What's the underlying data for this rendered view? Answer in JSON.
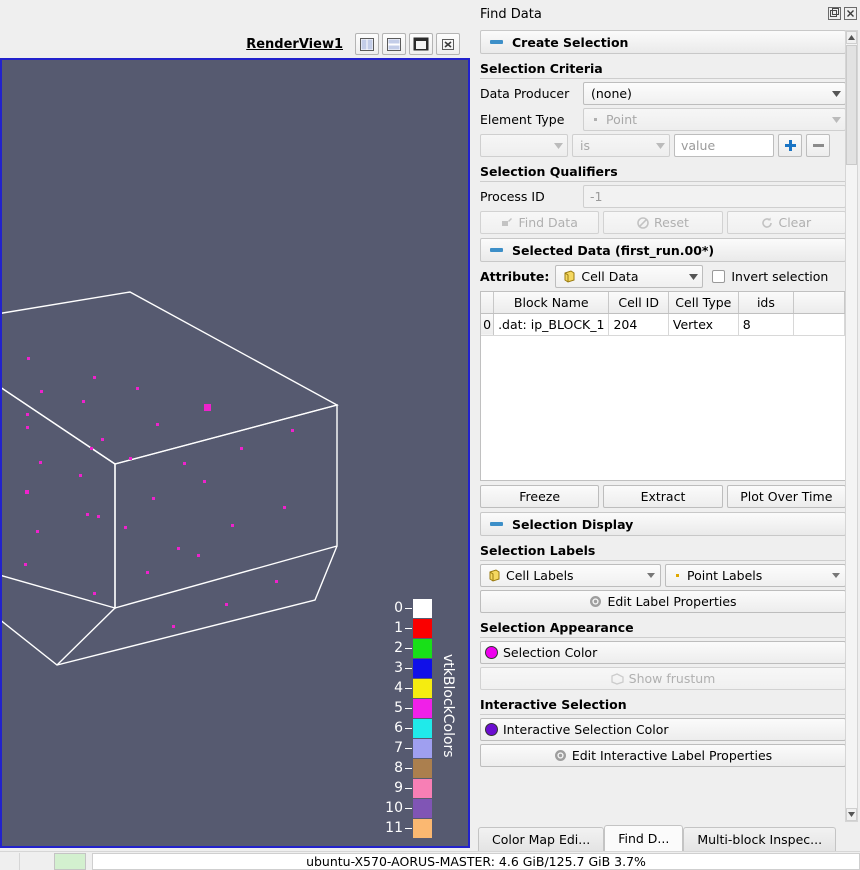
{
  "render_view": {
    "title": "RenderView1",
    "buttons": [
      {
        "name": "split-horizontal-button",
        "label": "Split Horizontal"
      },
      {
        "name": "split-vertical-button",
        "label": "Split Vertical"
      },
      {
        "name": "maximize-button",
        "label": "Maximize"
      },
      {
        "name": "close-view-button",
        "label": "Close"
      }
    ],
    "background_color": "#565a70",
    "active_border_color": "#2222cc",
    "wireframe_color": "#ffffff",
    "point_color": "#ee22cc",
    "legend": {
      "title": "vtkBlockColors",
      "entries": [
        {
          "label": "0",
          "color": "#ffffff"
        },
        {
          "label": "1",
          "color": "#fa0000"
        },
        {
          "label": "2",
          "color": "#18e018"
        },
        {
          "label": "3",
          "color": "#1010e8"
        },
        {
          "label": "4",
          "color": "#f5ec10"
        },
        {
          "label": "5",
          "color": "#f020e8"
        },
        {
          "label": "6",
          "color": "#20eaea"
        },
        {
          "label": "7",
          "color": "#9f9ff0"
        },
        {
          "label": "8",
          "color": "#ab7f4e"
        },
        {
          "label": "9",
          "color": "#f77fb5"
        },
        {
          "label": "10",
          "color": "#8055b5"
        },
        {
          "label": "11",
          "color": "#fbb871"
        }
      ]
    }
  },
  "dock": {
    "title": "Find Data",
    "float_icon": "float-icon",
    "close_icon": "close-icon"
  },
  "create_selection": {
    "header": "Create Selection",
    "criteria_title": "Selection Criteria",
    "data_producer_label": "Data Producer",
    "data_producer_value": "(none)",
    "element_type_label": "Element Type",
    "element_type_value": "Point",
    "query_field_value": "",
    "query_operator_value": "is",
    "query_value_placeholder": "value",
    "add_button": "+",
    "remove_button": "−",
    "qualifiers_title": "Selection Qualifiers",
    "process_id_label": "Process ID",
    "process_id_value": "-1",
    "find_data_button": "Find Data",
    "reset_button": "Reset",
    "clear_button": "Clear"
  },
  "selected_data": {
    "header": "Selected Data (first_run.00*)",
    "attribute_label": "Attribute:",
    "attribute_value": "Cell Data",
    "invert_label": "Invert selection",
    "columns": [
      "Block Name",
      "Cell ID",
      "Cell Type",
      "ids"
    ],
    "rows": [
      {
        "index": "0",
        "cells": [
          ".dat: ip_BLOCK_1",
          "204",
          "Vertex",
          "8"
        ]
      }
    ],
    "freeze_button": "Freeze",
    "extract_button": "Extract",
    "plot_over_time_button": "Plot Over Time"
  },
  "selection_display": {
    "header": "Selection Display",
    "labels_title": "Selection Labels",
    "cell_labels": "Cell Labels",
    "point_labels": "Point Labels",
    "edit_label_properties": "Edit Label Properties",
    "appearance_title": "Selection Appearance",
    "selection_color_label": "Selection Color",
    "selection_color": "#ee00ee",
    "show_frustum_button": "Show frustum",
    "interactive_title": "Interactive Selection",
    "interactive_color_label": "Interactive Selection Color",
    "interactive_color": "#6a0dd0",
    "edit_interactive_label_properties": "Edit Interactive Label Properties"
  },
  "tabs": [
    {
      "label": "Color Map Edi...",
      "active": false
    },
    {
      "label": "Find D...",
      "active": true
    },
    {
      "label": "Multi-block Inspec...",
      "active": false
    }
  ],
  "status_bar": {
    "text": "ubuntu-X570-AORUS-MASTER: 4.6 GiB/125.7 GiB 3.7%"
  }
}
